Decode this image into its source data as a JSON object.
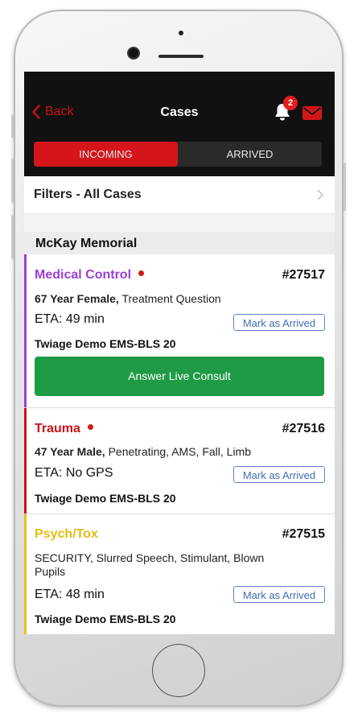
{
  "nav": {
    "back_label": "Back",
    "title": "Cases",
    "notification_count": "2"
  },
  "tabs": [
    {
      "label": "INCOMING",
      "active": true
    },
    {
      "label": "ARRIVED",
      "active": false
    }
  ],
  "filters": {
    "label": "Filters - All Cases"
  },
  "section": {
    "title": "McKay Memorial"
  },
  "cases": [
    {
      "category": "Medical Control",
      "category_color": "#9b3fd6",
      "bar_color": "#9b3fd6",
      "number": "#27517",
      "patient": "67 Year Female,",
      "details": " Treatment Question",
      "eta": "ETA: 49 min",
      "mark_label": "Mark as Arrived",
      "agency": "Twiage Demo EMS-BLS 20",
      "consult_label": "Answer Live Consult"
    },
    {
      "category": "Trauma",
      "category_color": "#c8141b",
      "bar_color": "#c8141b",
      "number": "#27516",
      "patient": "47 Year Male,",
      "details": " Penetrating, AMS, Fall, Limb",
      "eta": "ETA: No GPS",
      "mark_label": "Mark as Arrived",
      "agency": "Twiage Demo EMS-BLS 20"
    },
    {
      "category": "Psych/Tox",
      "category_color": "#e5bc12",
      "bar_color": "#e8c21a",
      "number": "#27515",
      "details": "SECURITY, Slurred Speech, Stimulant, Blown Pupils",
      "eta": "ETA: 48 min",
      "mark_label": "Mark as Arrived",
      "agency": "Twiage Demo EMS-BLS 20"
    }
  ]
}
